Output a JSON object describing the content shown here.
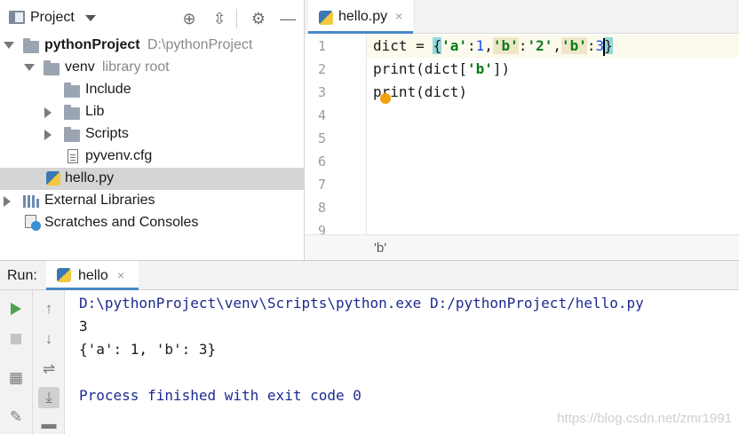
{
  "project_panel": {
    "title": "Project",
    "toolbar_icons": [
      "crosshair-icon",
      "collapse-icon",
      "gear-icon",
      "minimize-icon"
    ],
    "tree": {
      "root_label": "pythonProject",
      "root_path": "D:\\pythonProject",
      "venv_label": "venv",
      "venv_hint": "library root",
      "include_label": "Include",
      "lib_label": "Lib",
      "scripts_label": "Scripts",
      "cfg_label": "pyvenv.cfg",
      "hello_label": "hello.py",
      "external_label": "External Libraries",
      "scratches_label": "Scratches and Consoles"
    }
  },
  "editor": {
    "tab_label": "hello.py",
    "tab_close": "×",
    "line_numbers": [
      "1",
      "2",
      "3",
      "4",
      "5",
      "6",
      "7",
      "8",
      "9"
    ],
    "code": {
      "l1_a": "dict = ",
      "l1_brace_open": "{",
      "l1_s1": "'a'",
      "l1_c1": ":",
      "l1_n1": "1",
      "l1_c2": ",",
      "l1_s2": "'b'",
      "l1_c3": ":",
      "l1_s3": "'2'",
      "l1_c4": ",",
      "l1_s4": "'b'",
      "l1_c5": ":",
      "l1_n2": "3",
      "l1_brace_close": "}",
      "l2_a": "print(dict[",
      "l2_s": "'b'",
      "l2_b": "])",
      "l3": "print(dict)"
    },
    "breadcrumb": "'b'"
  },
  "run_panel": {
    "label": "Run:",
    "tab_label": "hello",
    "tab_close": "×",
    "console": {
      "command": "D:\\pythonProject\\venv\\Scripts\\python.exe D:/pythonProject/hello.py",
      "out1": "3",
      "out2": "{'a': 1, 'b': 3}",
      "exit": "Process finished with exit code 0"
    },
    "watermark": "https://blog.csdn.net/zmr1991"
  },
  "icons": {
    "up": "↑",
    "down": "↓",
    "wrap": "⇌",
    "scroll_end": "⤓",
    "layout": "▦",
    "pin": "✎",
    "print": "▬",
    "crosshair": "⊕",
    "collapse": "⇳",
    "gear": "⚙",
    "minimize": "—"
  }
}
